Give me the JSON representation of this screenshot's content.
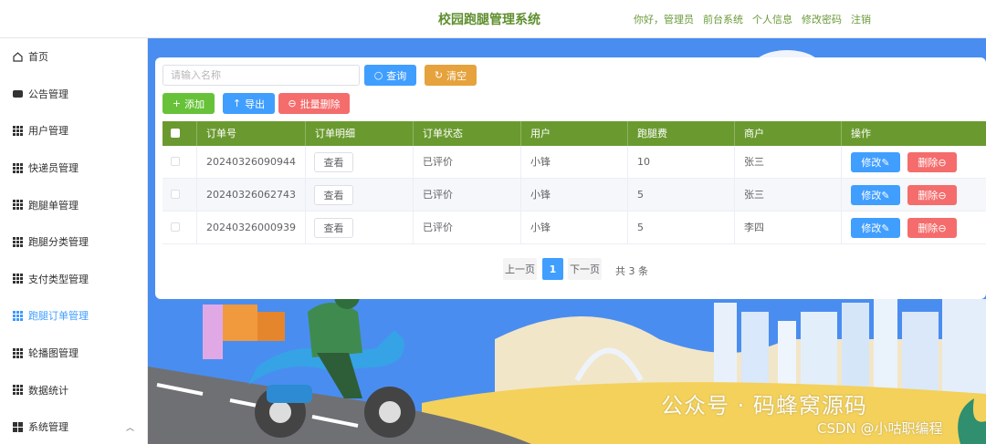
{
  "header": {
    "title": "校园跑腿管理系统",
    "greeting": "你好，管理员",
    "links": [
      "前台系统",
      "个人信息",
      "修改密码",
      "注销"
    ]
  },
  "sidebar": {
    "items": [
      {
        "label": "首页",
        "icon": "home-icon"
      },
      {
        "label": "公告管理",
        "icon": "chat-icon"
      },
      {
        "label": "用户管理",
        "icon": "grid-icon"
      },
      {
        "label": "快递员管理",
        "icon": "grid-icon"
      },
      {
        "label": "跑腿单管理",
        "icon": "grid-icon"
      },
      {
        "label": "跑腿分类管理",
        "icon": "grid-icon"
      },
      {
        "label": "支付类型管理",
        "icon": "grid-icon"
      },
      {
        "label": "跑腿订单管理",
        "icon": "grid-icon",
        "active": true
      },
      {
        "label": "轮播图管理",
        "icon": "grid-icon"
      },
      {
        "label": "数据统计",
        "icon": "grid-icon"
      },
      {
        "label": "系统管理",
        "icon": "grid4-icon"
      }
    ],
    "active_color": "#409eff"
  },
  "toolbar": {
    "search_placeholder": "请输入名称",
    "query_label": "查询",
    "clear_label": "清空",
    "add_label": "添加",
    "export_label": "导出",
    "batch_delete_label": "批量删除"
  },
  "table": {
    "header_color": "#6a9a2f",
    "columns": [
      "订单号",
      "订单明细",
      "订单状态",
      "用户",
      "跑腿费",
      "商户",
      "操作"
    ],
    "rows": [
      {
        "order_no": "20240326090944",
        "detail": "查看",
        "status": "已评价",
        "user": "小锋",
        "fee": "10",
        "merchant": "张三"
      },
      {
        "order_no": "20240326062743",
        "detail": "查看",
        "status": "已评价",
        "user": "小锋",
        "fee": "5",
        "merchant": "张三"
      },
      {
        "order_no": "20240326000939",
        "detail": "查看",
        "status": "已评价",
        "user": "小锋",
        "fee": "5",
        "merchant": "李四"
      }
    ],
    "edit_label": "修改",
    "delete_label": "删除"
  },
  "pagination": {
    "prev_label": "上一页",
    "current": "1",
    "next_label": "下一页",
    "total_label": "共 3 条"
  },
  "watermark": {
    "line1": "公众号 · 码蜂窝源码",
    "line2": "CSDN @小咕职编程"
  }
}
